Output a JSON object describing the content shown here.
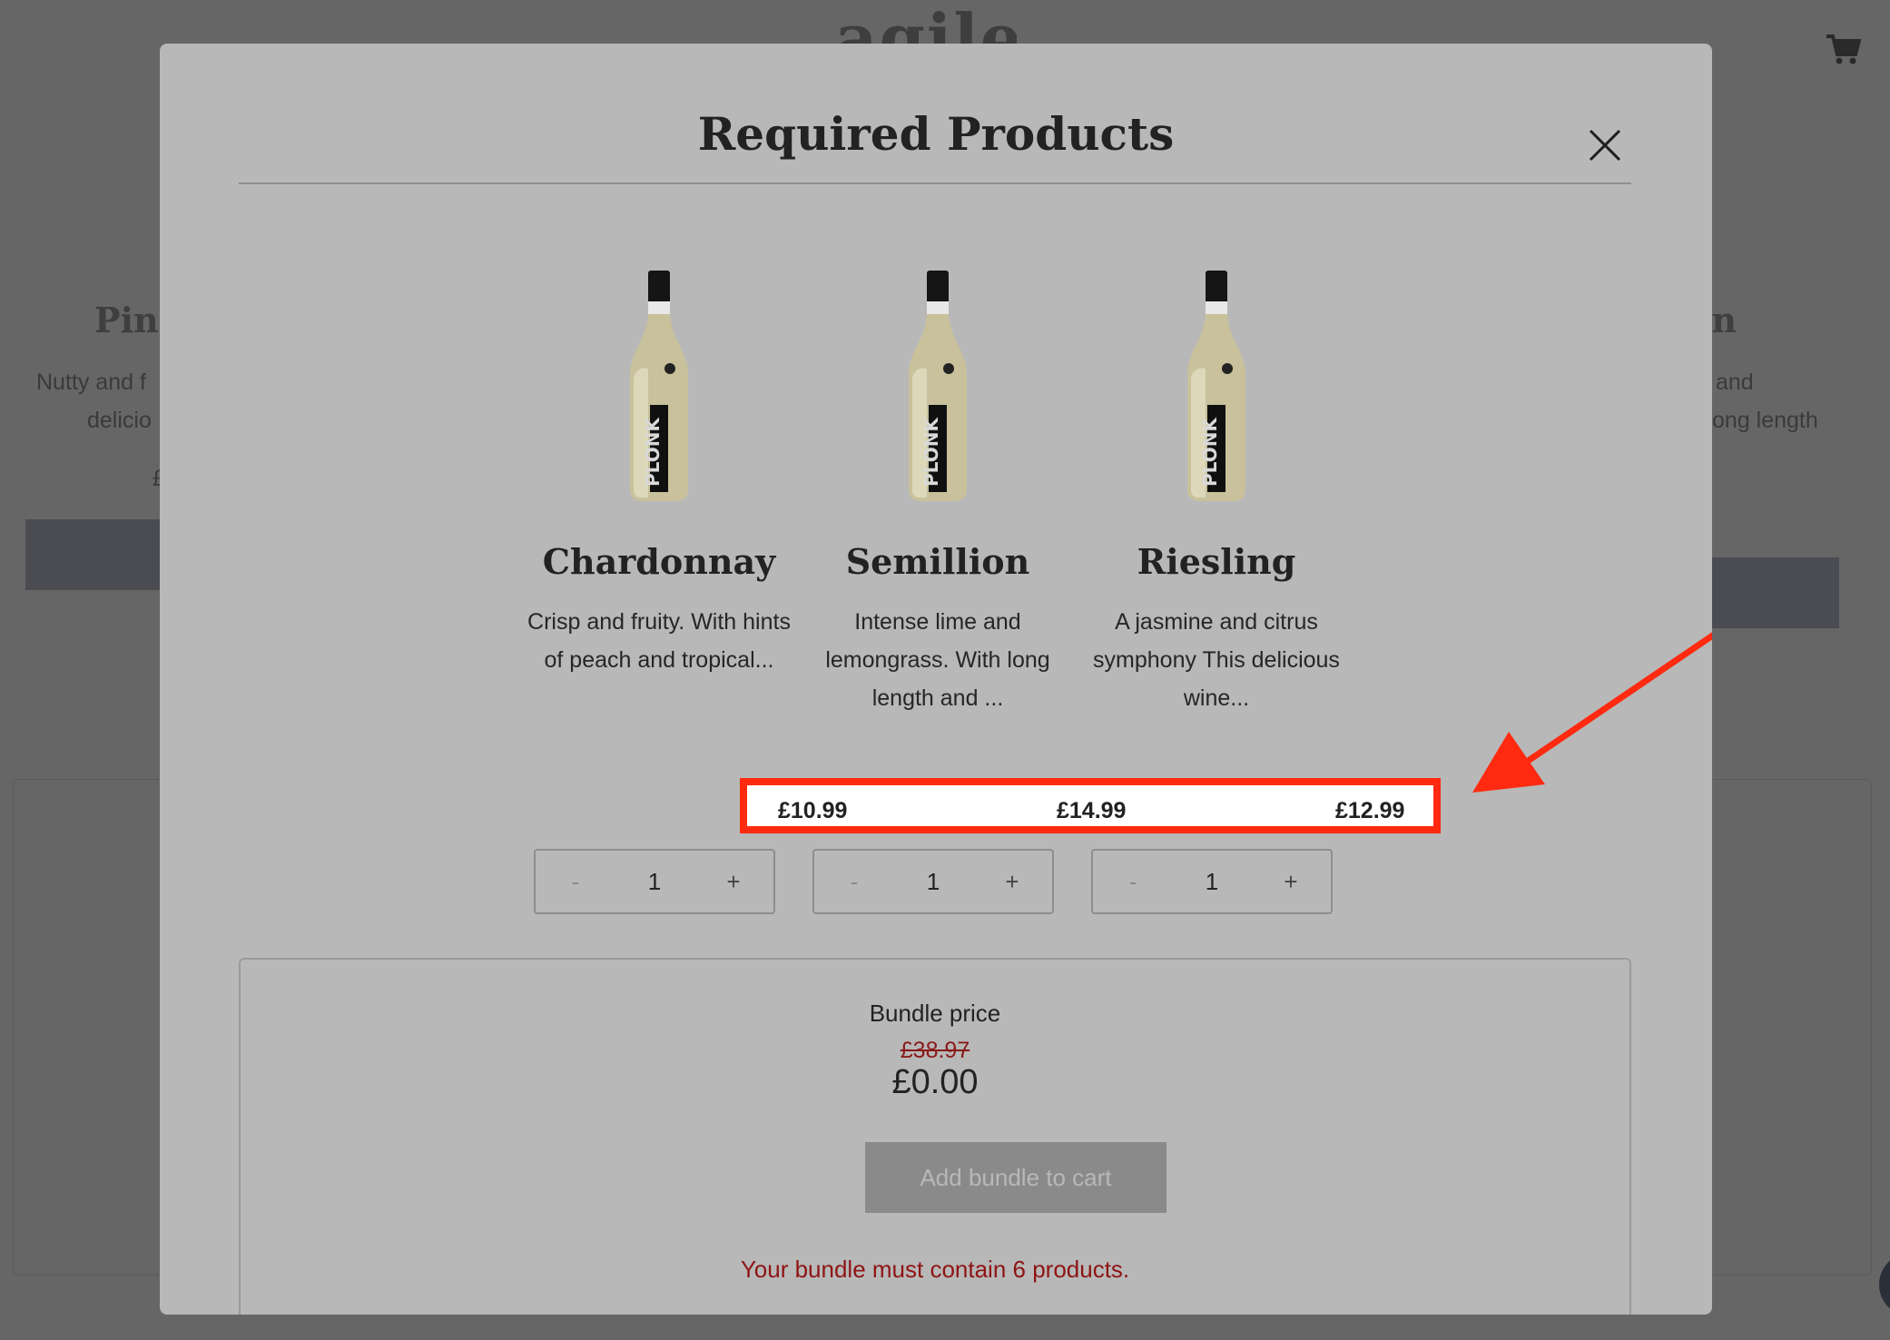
{
  "background": {
    "logo_text": "agile",
    "left_card": {
      "title": "Pinc",
      "desc_lines": [
        "Nutty and f",
        "delicio"
      ],
      "price_fragment": "£"
    },
    "right_card": {
      "title": "on",
      "desc_lines": [
        "and",
        "ong length"
      ]
    }
  },
  "modal": {
    "title": "Required Products",
    "close_icon": "close-icon"
  },
  "products": [
    {
      "name": "Chardonnay",
      "description": "Crisp and fruity. With hints of peach and tropical...",
      "price": "£10.99",
      "quantity": "1",
      "minus_label": "-",
      "plus_label": "+"
    },
    {
      "name": "Semillion",
      "description": "Intense lime and lemongrass. With long length and ...",
      "price": "£14.99",
      "quantity": "1",
      "minus_label": "-",
      "plus_label": "+"
    },
    {
      "name": "Riesling",
      "description": "A jasmine and citrus symphony  This delicious wine...",
      "price": "£12.99",
      "quantity": "1",
      "minus_label": "-",
      "plus_label": "+"
    }
  ],
  "bottle_label": "PLONK",
  "bundle": {
    "label": "Bundle price",
    "original_price": "£38.97",
    "current_price": "£0.00",
    "add_button": "Add bundle to cart",
    "error_message": "Your bundle must contain 6 products."
  },
  "colors": {
    "annotation_red": "#ff2a10",
    "error_red": "#8e1414",
    "overlay": "#666666",
    "modal_bg": "#b8b8b8"
  }
}
